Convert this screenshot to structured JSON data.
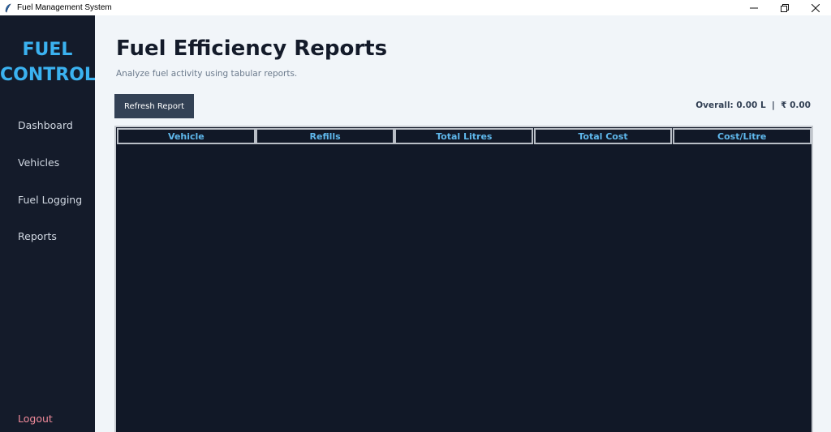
{
  "window": {
    "title": "Fuel Management System",
    "controls": [
      "minimize-icon",
      "restore-icon",
      "close-icon"
    ]
  },
  "sidebar": {
    "brand_line1": "FUEL",
    "brand_line2": "CONTROL",
    "items": [
      {
        "label": "Dashboard"
      },
      {
        "label": "Vehicles"
      },
      {
        "label": "Fuel Logging"
      },
      {
        "label": "Reports"
      }
    ],
    "logout_label": "Logout"
  },
  "main": {
    "title": "Fuel Efficiency Reports",
    "subtitle": "Analyze fuel activity using tabular reports.",
    "refresh_label": "Refresh Report",
    "overall": "Overall: 0.00 L  |  ₹ 0.00"
  },
  "table": {
    "columns": [
      "Vehicle",
      "Refills",
      "Total Litres",
      "Total Cost",
      "Cost/Litre"
    ],
    "rows": []
  },
  "colors": {
    "sidebar_bg": "#141b2a",
    "brand": "#3bb2f0",
    "table_bg": "#111827",
    "header_text": "#5fb8ec",
    "logout": "#f08a9a",
    "button_bg": "#334155"
  }
}
